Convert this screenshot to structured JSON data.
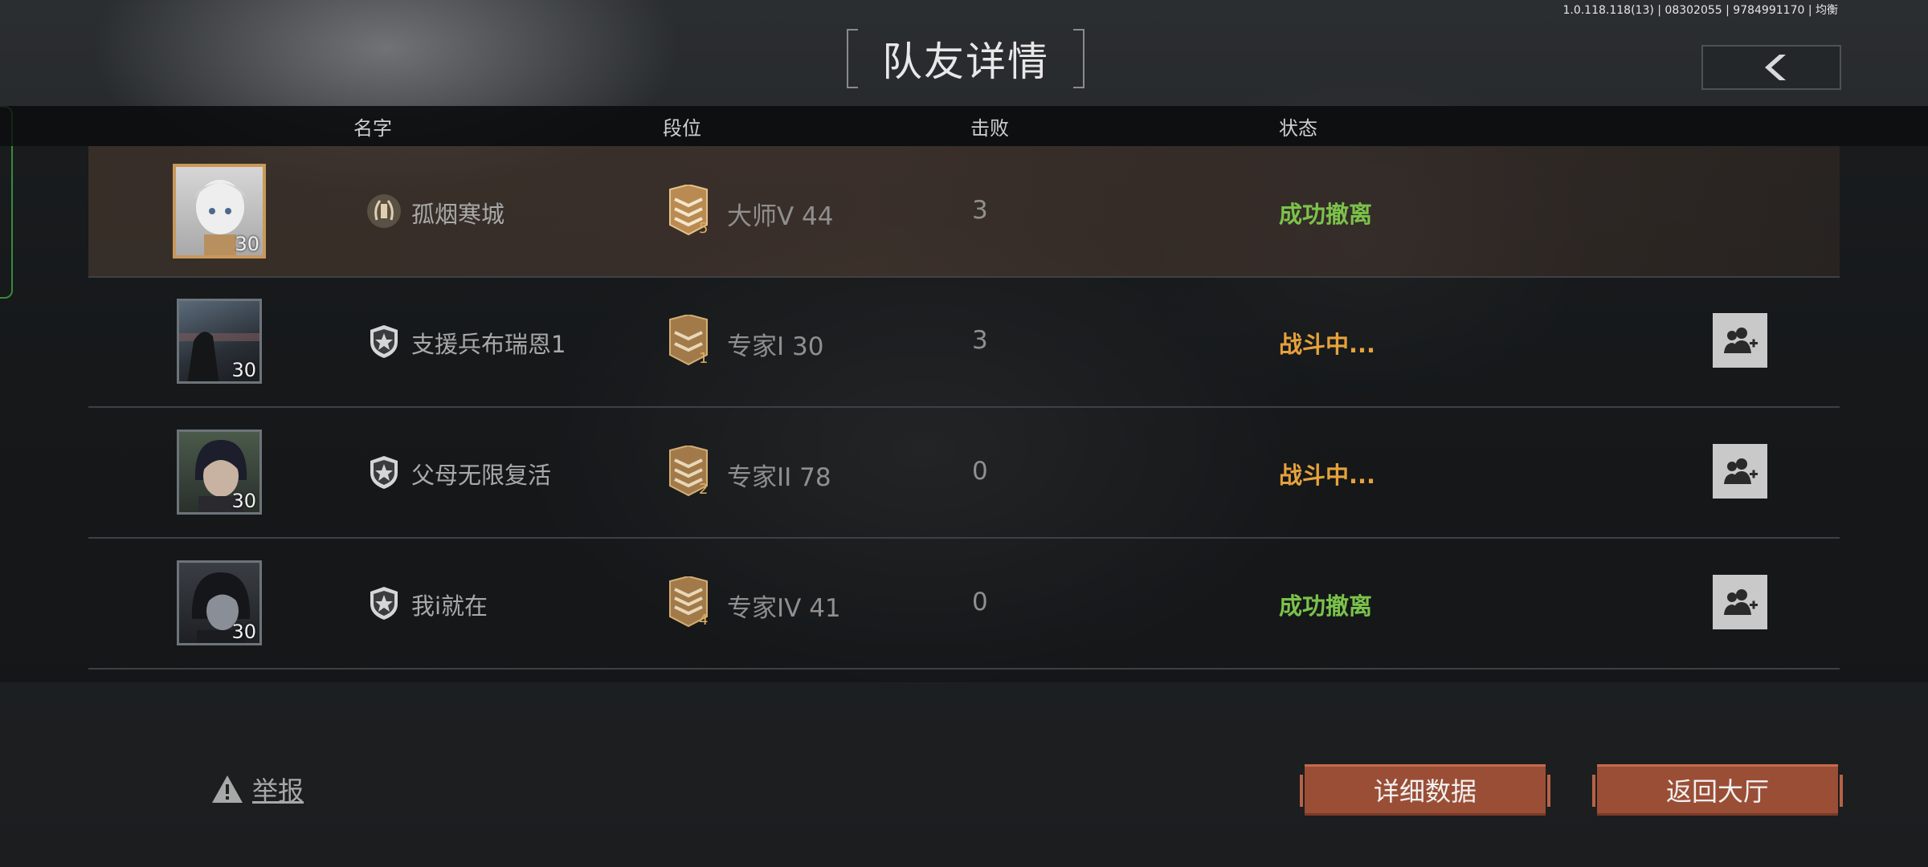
{
  "version": "1.0.118.118(13) | 08302055 | 9784991170 | 均衡",
  "title": "队友详情",
  "headers": {
    "name": "名字",
    "rank": "段位",
    "kills": "击败",
    "status": "状态"
  },
  "players": [
    {
      "name": "孤烟寒城",
      "level": "30",
      "rank": "大师V 44",
      "rank_badge": "5",
      "kills": "3",
      "status": "成功撤离",
      "status_color": "#7bc24a",
      "name_icon": "laurel-emblem-icon",
      "can_add_friend": false
    },
    {
      "name": "支援兵布瑞恩1",
      "level": "30",
      "rank": "专家I 30",
      "rank_badge": "1",
      "kills": "3",
      "status": "战斗中...",
      "status_color": "#e6a23c",
      "name_icon": "star-shield-icon",
      "can_add_friend": true
    },
    {
      "name": "父母无限复活",
      "level": "30",
      "rank": "专家II 78",
      "rank_badge": "2",
      "kills": "0",
      "status": "战斗中...",
      "status_color": "#e6a23c",
      "name_icon": "star-shield-icon",
      "can_add_friend": true
    },
    {
      "name": "我i就在",
      "level": "30",
      "rank": "专家IV 41",
      "rank_badge": "4",
      "kills": "0",
      "status": "成功撤离",
      "status_color": "#7bc24a",
      "name_icon": "star-shield-icon",
      "can_add_friend": true
    }
  ],
  "report_label": "举报",
  "details_button": "详细数据",
  "lobby_button": "返回大厅",
  "colors": {
    "button_bg": "#9b4e36",
    "success": "#7bc24a",
    "in_battle": "#e6a23c"
  }
}
